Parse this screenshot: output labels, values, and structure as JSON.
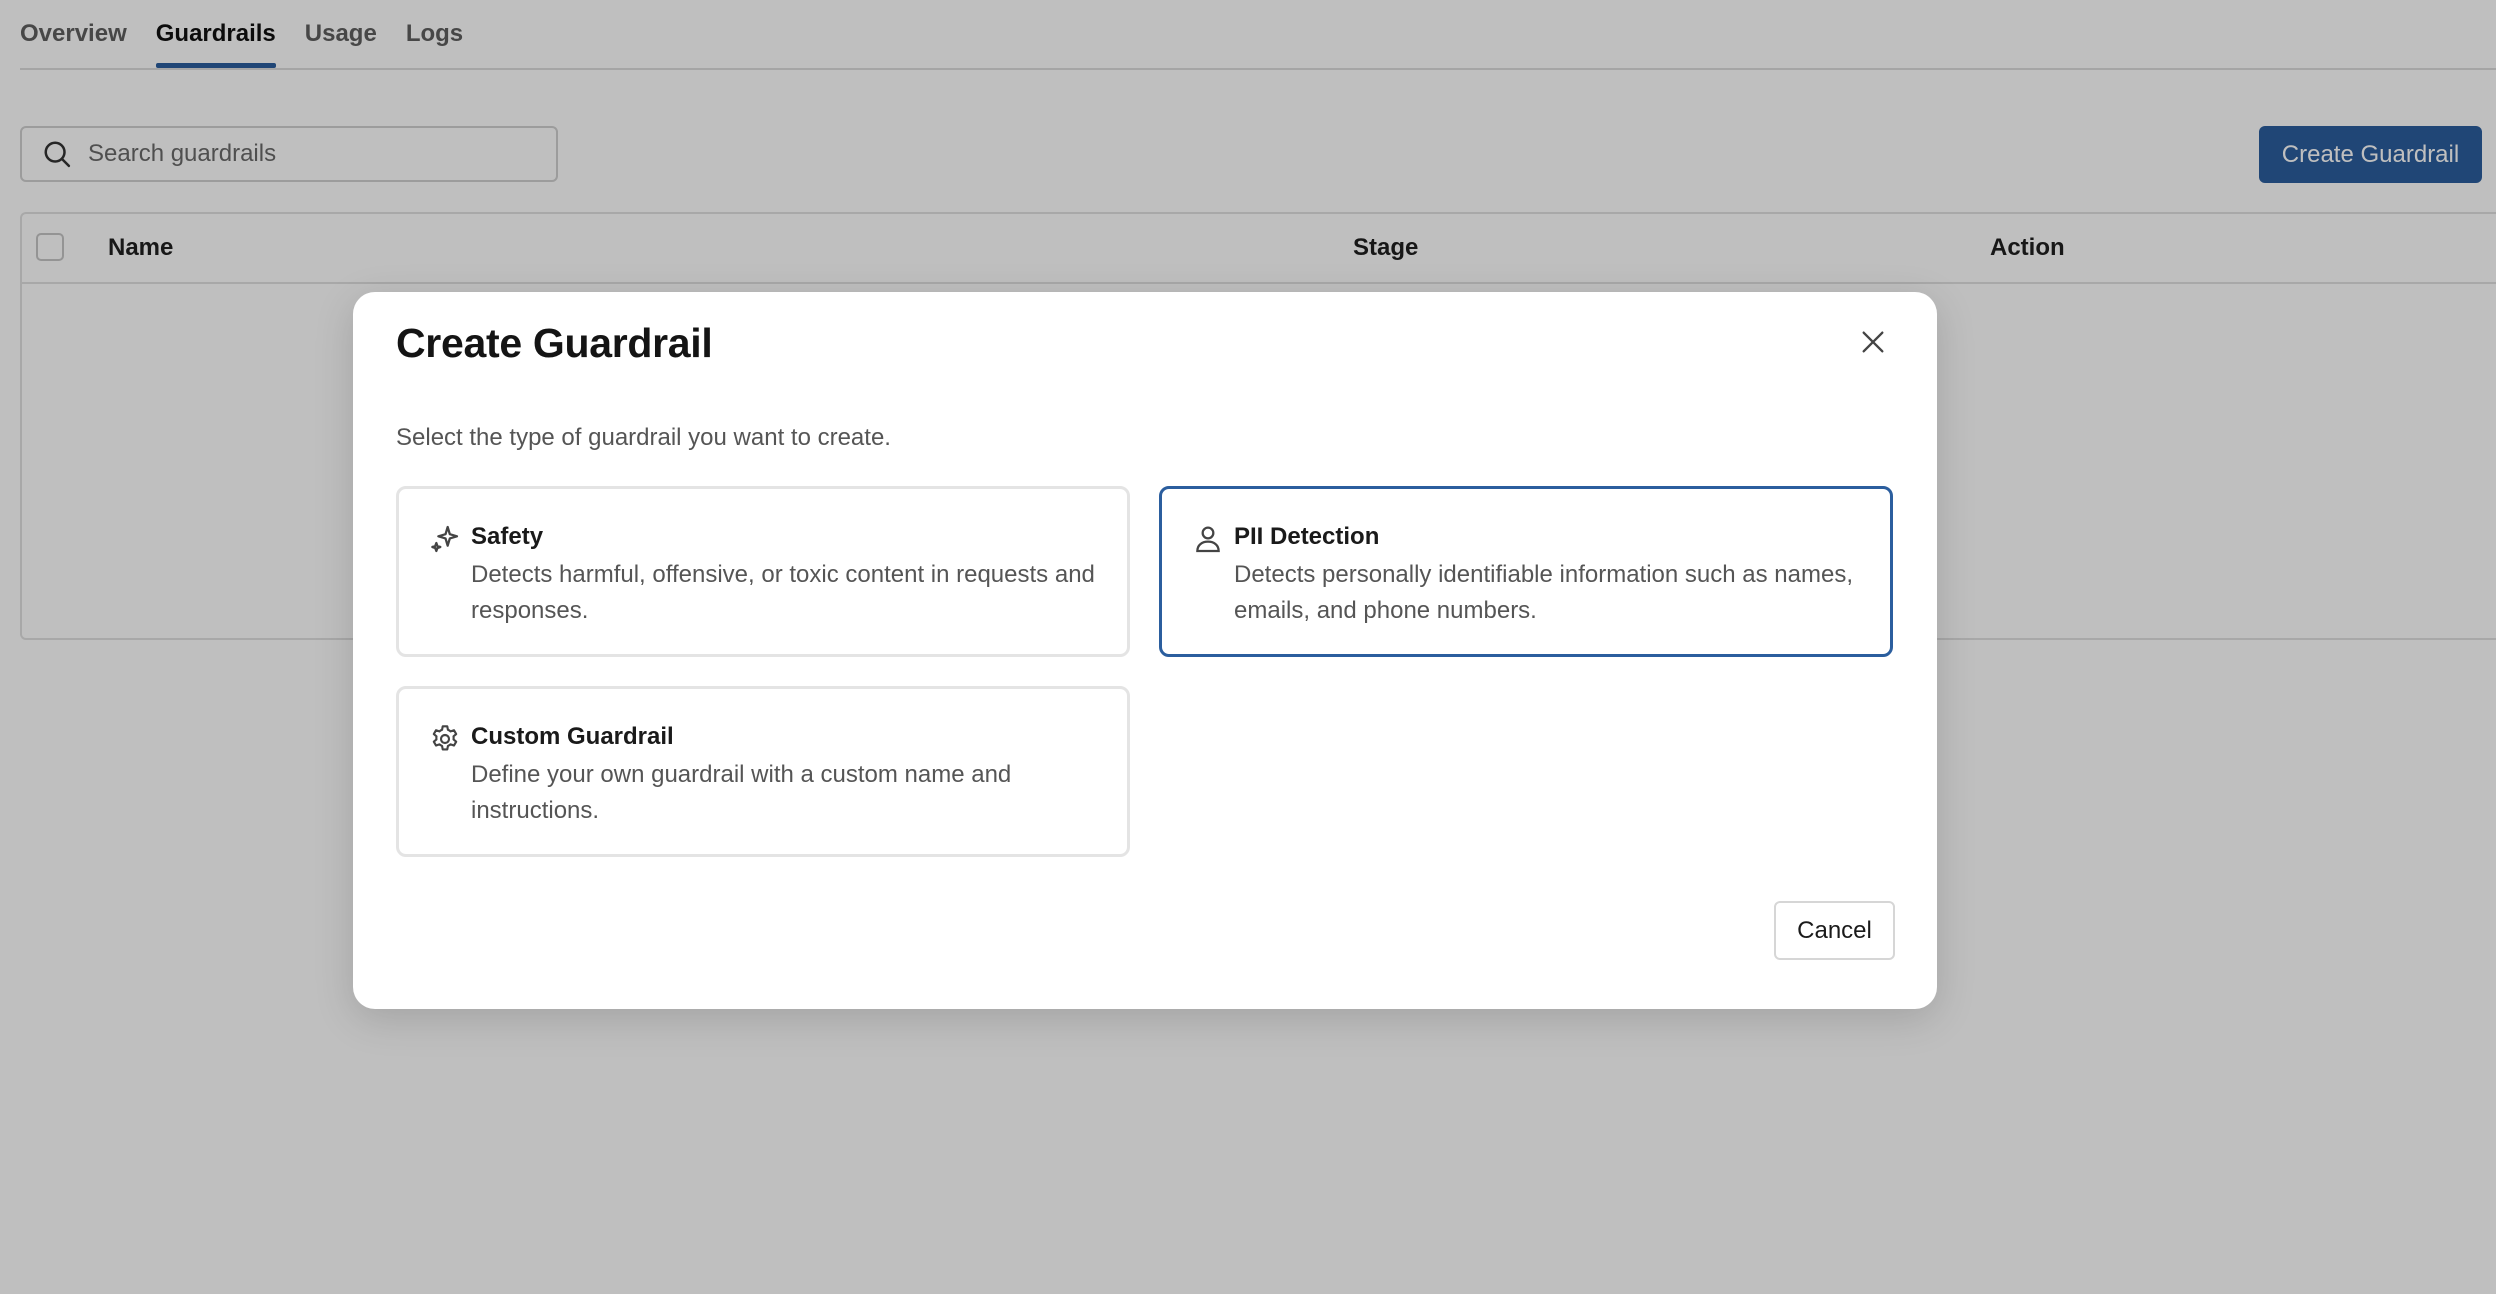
{
  "tabs": [
    {
      "label": "Overview",
      "active": false
    },
    {
      "label": "Guardrails",
      "active": true
    },
    {
      "label": "Usage",
      "active": false
    },
    {
      "label": "Logs",
      "active": false
    }
  ],
  "search": {
    "placeholder": "Search guardrails",
    "value": "",
    "icon": "search-icon"
  },
  "toolbar": {
    "create_label": "Create Guardrail"
  },
  "table": {
    "columns": [
      "Name",
      "Stage",
      "Action"
    ]
  },
  "modal": {
    "title": "Create Guardrail",
    "description": "Select the type of guardrail you want to create.",
    "options": [
      {
        "title": "Safety",
        "description": "Detects harmful, offensive, or toxic content in requests and responses.",
        "icon": "sparkle-icon",
        "selected": false
      },
      {
        "title": "PII Detection",
        "description": "Detects personally identifiable information such as names, emails, and phone numbers.",
        "icon": "user-icon",
        "selected": true
      },
      {
        "title": "Custom Guardrail",
        "description": "Define your own guardrail with a custom name and instructions.",
        "icon": "gear-icon",
        "selected": false
      }
    ],
    "cancel_label": "Cancel",
    "close_icon": "close-icon"
  },
  "colors": {
    "accent": "#2b5e9e",
    "overlay": "rgba(0,0,0,0.25)"
  }
}
